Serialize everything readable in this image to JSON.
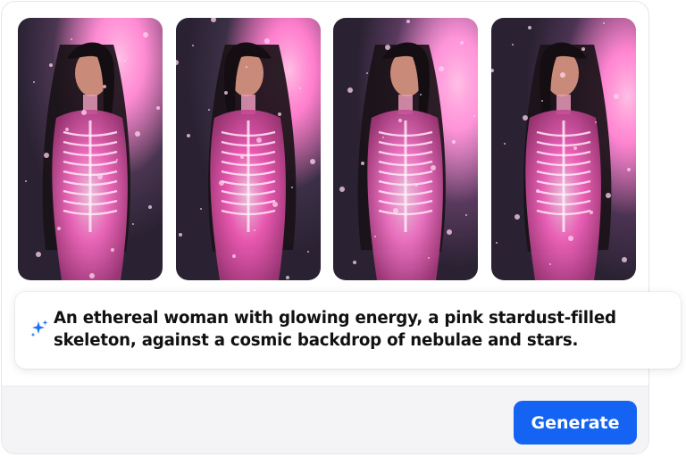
{
  "gallery": {
    "images": [
      {
        "name": "generated-image-1",
        "bg": "#4a3550",
        "glow": "#ff6fc8"
      },
      {
        "name": "generated-image-2",
        "bg": "#3b3046",
        "glow": "#ff5fc0"
      },
      {
        "name": "generated-image-3",
        "bg": "#5a3a5e",
        "glow": "#ff7ad0"
      },
      {
        "name": "generated-image-4",
        "bg": "#4b3352",
        "glow": "#ff68c6"
      }
    ]
  },
  "prompt": {
    "icon": "sparkles-icon",
    "text": "An ethereal woman with glowing energy,  a pink stardust-filled\nskeleton, against a cosmic backdrop of nebulae and stars."
  },
  "actions": {
    "generate_label": "Generate"
  },
  "colors": {
    "accent": "#1463f3",
    "footer_bg": "#f4f4f6"
  }
}
